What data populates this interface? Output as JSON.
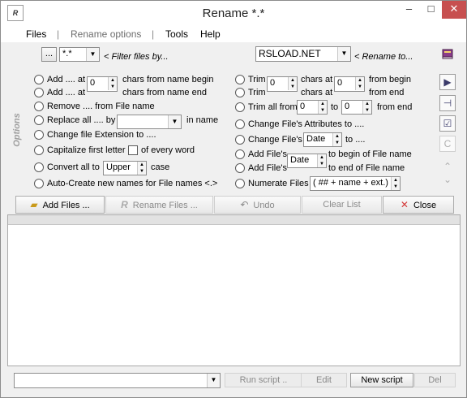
{
  "window": {
    "title": "Rename  *.*",
    "icon_letter": "R",
    "controls": {
      "minimize": "–",
      "maximize": "□",
      "close": "✕"
    }
  },
  "menu": {
    "items": [
      "Files",
      "Rename options",
      "Tools",
      "Help"
    ],
    "separators": [
      "|",
      "|"
    ]
  },
  "filter": {
    "browse_label": "...",
    "value": "*.*",
    "hint": "< Filter files by..."
  },
  "rename_to": {
    "value": "RSLOAD.NET",
    "hint": "< Rename to..."
  },
  "options_label": "Options",
  "left_options": {
    "add_begin": {
      "a": "Add .... at",
      "value": "0",
      "b": "chars from name begin"
    },
    "add_end": {
      "a": "Add .... at",
      "b": "chars from name end"
    },
    "remove": "Remove .... from File name",
    "replace": {
      "a": "Replace all .... by",
      "value": "",
      "b": "in name"
    },
    "change_ext": "Change file Extension to ....",
    "capitalize": {
      "a": "Capitalize first letter",
      "b": "of every word"
    },
    "convert": {
      "a": "Convert all to",
      "value": "Upper",
      "b": "case"
    },
    "auto_create": "Auto-Create new names for File names <.>"
  },
  "right_options": {
    "trim_begin": {
      "a": "Trim",
      "value": "0",
      "b": "chars at",
      "value2": "0",
      "c": "from begin"
    },
    "trim_end": {
      "a": "Trim",
      "b": "chars at",
      "c": "from  end"
    },
    "trim_all": {
      "a": "Trim all from",
      "from": "0",
      "to_label": "to",
      "to": "0",
      "c": "from end"
    },
    "attributes": "Change File's Attributes to ....",
    "change_date": {
      "a": "Change File's",
      "value": "Date",
      "b": "to ...."
    },
    "add_date_begin": {
      "a": "Add File's",
      "value": "Date",
      "b": "to begin of File name"
    },
    "add_date_end": {
      "a": "Add File's",
      "b": "to end of File name"
    },
    "numerate": {
      "a": "Numerate Files",
      "value": "( ## + name + ext.)"
    }
  },
  "sidebar": {
    "icons": [
      "book-icon",
      "play-icon",
      "pin-icon",
      "checkbox-icon",
      "c-icon",
      "up-icon",
      "down-icon"
    ],
    "glyphs": {
      "play": "▶",
      "pin": "⊣",
      "check": "☑",
      "c": "C",
      "up": "⌃",
      "down": "⌄"
    }
  },
  "toolbar": {
    "add_files": "Add Files ...",
    "rename_files": "Rename Files ...",
    "undo": "Undo",
    "clear_list": "Clear List",
    "close": "Close",
    "icons": {
      "add": "📂",
      "rename": "R",
      "undo": "↶",
      "close": "✕"
    }
  },
  "bottom": {
    "script_value": "",
    "run_script": "Run script ..",
    "edit": "Edit",
    "new_script": "New script",
    "del": "Del"
  },
  "colors": {
    "accent_close": "#c75050",
    "disabled_text": "#8a8a8a",
    "options_label": "#a0a0a0"
  }
}
